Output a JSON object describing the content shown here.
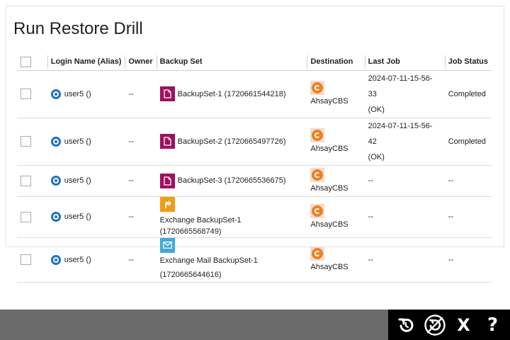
{
  "page": {
    "title": "Run Restore Drill"
  },
  "table": {
    "headers": [
      "Login Name (Alias)",
      "Owner",
      "Backup Set",
      "Destination",
      "Last Job",
      "Job Status"
    ],
    "rows": [
      {
        "login": "user5 ()",
        "owner": "--",
        "backup_set": "BackupSet-1 (1720661544218)",
        "backup_icon": "file-icon",
        "destination": "AhsayCBS",
        "last_job": "2024-07-11-15-56-33",
        "last_job_result": "(OK)",
        "job_status": "Completed"
      },
      {
        "login": "user5 ()",
        "owner": "--",
        "backup_set": "BackupSet-2 (1720665497726)",
        "backup_icon": "file-icon",
        "destination": "AhsayCBS",
        "last_job": "2024-07-11-15-56-42",
        "last_job_result": "(OK)",
        "job_status": "Completed"
      },
      {
        "login": "user5 ()",
        "owner": "--",
        "backup_set": "BackupSet-3 (1720665536675)",
        "backup_icon": "file-icon",
        "destination": "AhsayCBS",
        "last_job": "--",
        "last_job_result": "",
        "job_status": "--"
      },
      {
        "login": "user5 ()",
        "owner": "--",
        "backup_set": "Exchange BackupSet-1 (1720665568749)",
        "backup_icon": "exchange-icon",
        "destination": "AhsayCBS",
        "last_job": "--",
        "last_job_result": "",
        "job_status": "--"
      },
      {
        "login": "user5 ()",
        "owner": "--",
        "backup_set_line1": "Exchange Mail BackupSet-1",
        "backup_set_line2": "(1720665644616)",
        "backup_icon": "mail-icon",
        "destination": "AhsayCBS",
        "last_job": "--",
        "last_job_result": "",
        "job_status": "--"
      }
    ]
  },
  "toolbar": {
    "icons": [
      "restore-icon",
      "restore-drill-icon",
      "close-icon",
      "help-icon"
    ],
    "close_glyph": "X",
    "help_glyph": "?"
  },
  "colors": {
    "file_icon": "#a0105e",
    "exchange_icon": "#f39c12",
    "mail_icon": "#3fa9dd",
    "destination_icon": "#f08020",
    "user_icon": "#1a73c8",
    "bottom_bar": "#6b6b6b",
    "action_bar": "#000000"
  }
}
